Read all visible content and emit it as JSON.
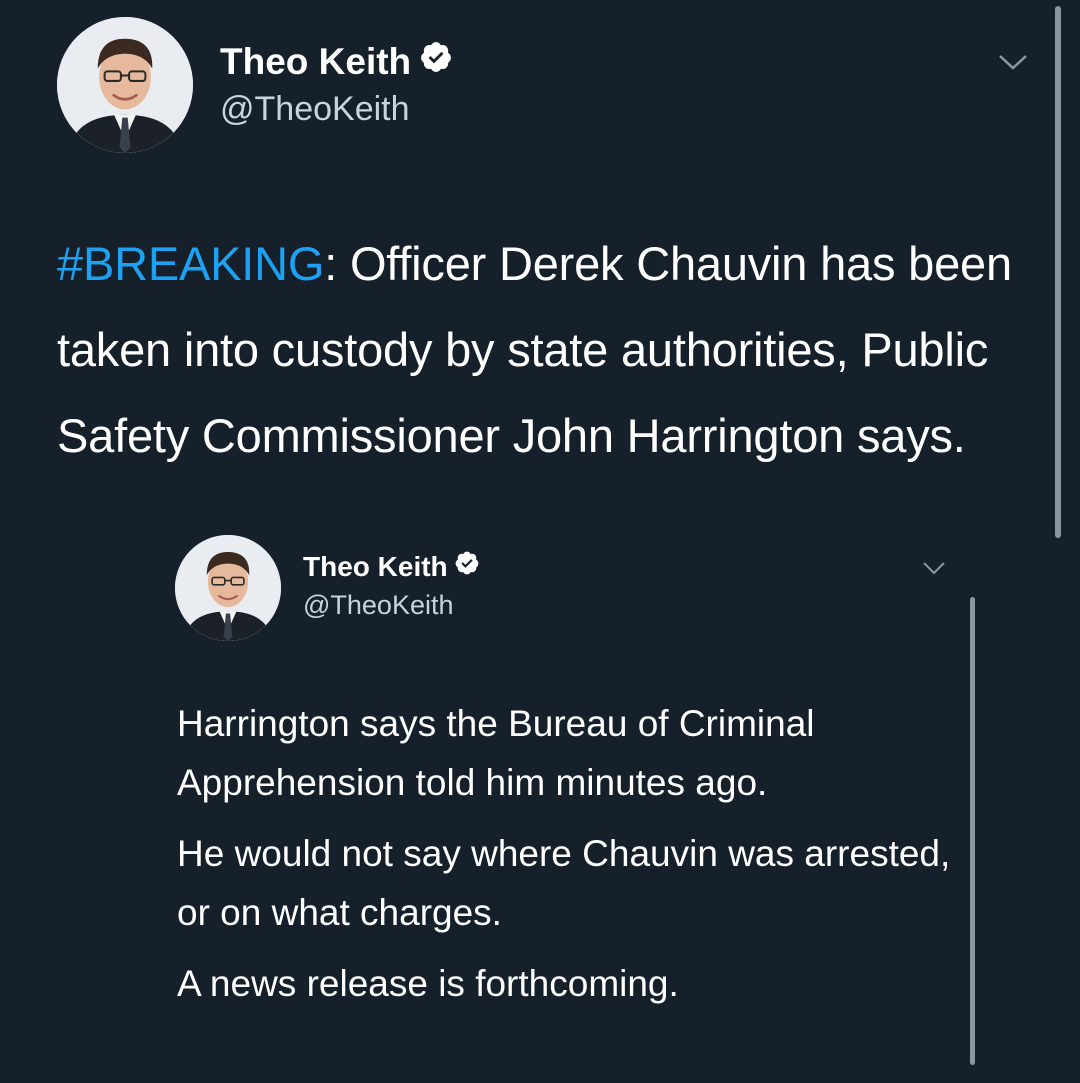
{
  "tweets": [
    {
      "author": {
        "name": "Theo Keith",
        "handle": "@TheoKeith",
        "verified": true,
        "avatar_icon": "avatar-photo-icon"
      },
      "hashtag": "#BREAKING",
      "text": ": Officer Derek Chauvin has been taken into custody by state authorities, Public Safety Commissioner John Harrington says."
    },
    {
      "author": {
        "name": "Theo Keith",
        "handle": "@TheoKeith",
        "verified": true,
        "avatar_icon": "avatar-photo-icon"
      },
      "paragraphs": [
        "Harrington says the Bureau of Criminal Apprehension told him minutes ago.",
        "He would not say where Chauvin was arrested, or on what charges.",
        "A news release is forthcoming."
      ]
    }
  ],
  "colors": {
    "background": "#15202b",
    "text": "#ffffff",
    "secondary_text": "#c9d3dc",
    "hashtag": "#1da1f2",
    "verified_badge": "#ffffff"
  },
  "icons": {
    "verified": "verified-badge-icon",
    "menu": "chevron-down-icon"
  }
}
